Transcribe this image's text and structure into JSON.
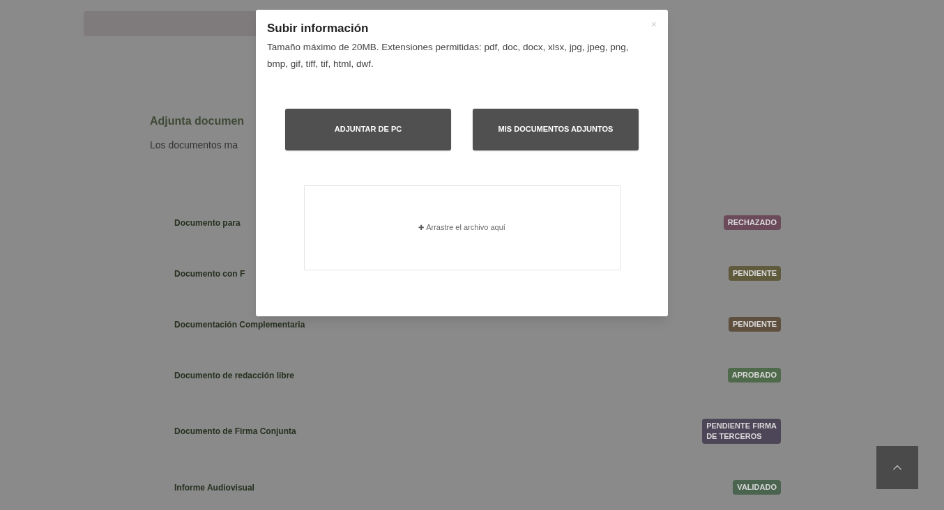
{
  "page": {
    "heading": "Adjunta documen",
    "subheading": "Los documentos ma",
    "documents": [
      {
        "name": "Documento para",
        "status": [
          "RECHAZADO"
        ],
        "color": "#6b4a5a"
      },
      {
        "name": "Documento con F",
        "status": [
          "PENDIENTE"
        ],
        "color": "#5f5a3c"
      },
      {
        "name": "Documentación Complementaria",
        "status": [
          "PENDIENTE"
        ],
        "color": "#5e4f3e"
      },
      {
        "name": "Documento de redacción libre",
        "status": [
          "APROBADO"
        ],
        "color": "#4f6a4a"
      },
      {
        "name": "Documento de Firma Conjunta",
        "status": [
          "PENDIENTE FIRMA",
          "DE TERCEROS"
        ],
        "color": "#4d4658"
      },
      {
        "name": "Informe Audiovisual",
        "status": [
          "VALIDADO"
        ],
        "color": "#4b6450"
      }
    ]
  },
  "modal": {
    "title": "Subir información",
    "close": "×",
    "description": "Tamaño máximo de 20MB. Extensiones permitidas: pdf, doc, docx, xlsx, jpg, jpeg, png, bmp, gif, tiff, tif, html, dwf.",
    "buttons": [
      "ADJUNTAR DE PC",
      "MIS DOCUMENTOS ADJUNTOS"
    ],
    "dropzone": {
      "icon": "✚",
      "text": "Arrastre el archivo aquí"
    }
  }
}
